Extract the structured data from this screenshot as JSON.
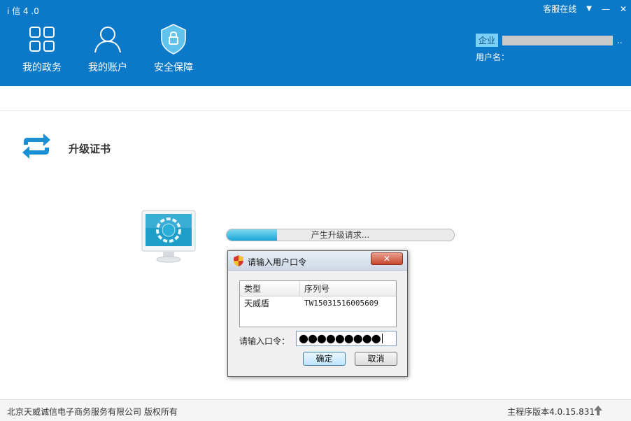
{
  "app": {
    "title": "i 信 4 .0"
  },
  "window": {
    "service_label": "客服在线",
    "dropdown_glyph": "▼",
    "minimize_glyph": "—",
    "close_glyph": "✕"
  },
  "nav": [
    {
      "label": "我的政务",
      "icon": "grid-icon"
    },
    {
      "label": "我的账户",
      "icon": "user-icon"
    },
    {
      "label": "安全保障",
      "icon": "shield-lock-icon"
    }
  ],
  "user": {
    "badge": "企业",
    "name_suffix": "..",
    "username_label": "用户名："
  },
  "section": {
    "title": "升级证书",
    "icon": "refresh-arrows-icon"
  },
  "progress": {
    "text": "产生升级请求...",
    "fraction": 0.22
  },
  "dialog": {
    "title": "请输入用户口令",
    "close_glyph": "✕",
    "columns": [
      "类型",
      "序列号"
    ],
    "rows": [
      {
        "type": "天威盾",
        "serial": "TW15031516005609"
      }
    ],
    "password_label": "请输入口令：",
    "password_value": "●●●●●●●●●",
    "ok_label": "确定",
    "cancel_label": "取消"
  },
  "footer": {
    "copyright": "北京天威诚信电子商务服务有限公司 版权所有",
    "version": "主程序版本4.0.15.831"
  },
  "colors": {
    "header_bg": "#0b78c8",
    "badge_bg": "#7ad0f5",
    "progress_fill": "#17a6d8"
  }
}
